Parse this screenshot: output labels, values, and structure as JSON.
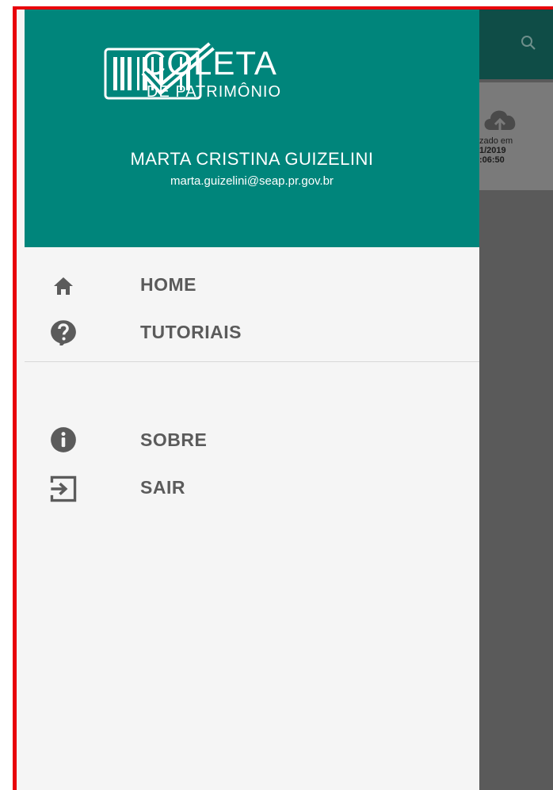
{
  "background": {
    "card": {
      "line1": "zado em",
      "line2": "1/2019",
      "line3": ":06:50"
    }
  },
  "drawer": {
    "logo": {
      "title": "COLETA",
      "subtitle": "DE PATRIMÔNIO"
    },
    "user": {
      "name": "MARTA CRISTINA GUIZELINI",
      "email": "marta.guizelini@seap.pr.gov.br"
    },
    "menu": [
      {
        "label": "HOME",
        "icon": "home-icon"
      },
      {
        "label": "TUTORIAIS",
        "icon": "help-icon"
      }
    ],
    "menu_secondary": [
      {
        "label": "SOBRE",
        "icon": "info-icon"
      },
      {
        "label": "SAIR",
        "icon": "logout-icon"
      }
    ]
  },
  "colors": {
    "header": "#00857b",
    "toolbar": "#0f4d47",
    "frame": "#e8000b",
    "menu_text": "#5b5b5b"
  }
}
